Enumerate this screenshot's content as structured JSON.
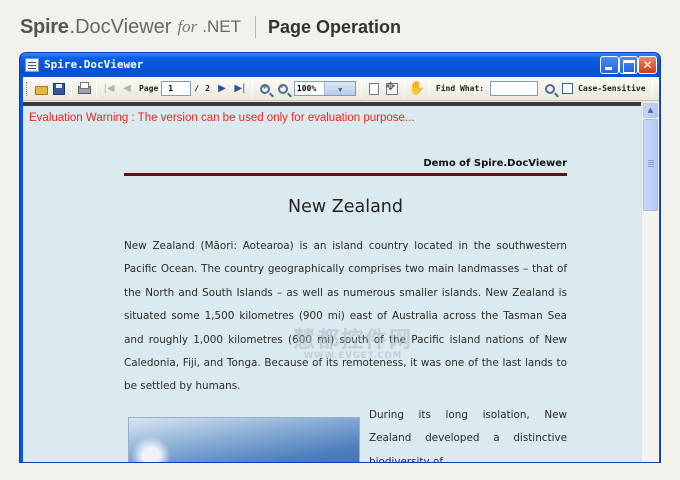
{
  "brand": {
    "product": "Spire",
    "product_suffix": ".DocViewer",
    "for_text": "for",
    "platform": ".NET",
    "section_title": "Page Operation"
  },
  "window": {
    "title": "Spire.DocViewer",
    "minimize": "",
    "maximize": "",
    "close": "✕"
  },
  "toolbar": {
    "page_label": "Page",
    "current_page": "1",
    "page_sep": "/",
    "total_pages": "2",
    "zoom_value": "100%",
    "zoom_arrow": "▼",
    "find_label": "Find What:",
    "case_label": "Case-Sensitive",
    "first_icon": "|◀",
    "prev_icon": "◀",
    "next_icon": "▶",
    "last_icon": "▶|",
    "hand_icon": "✋"
  },
  "document": {
    "warning": "Evaluation Warning : The version can be used only for evaluation purpose...",
    "header": "Demo of Spire.DocViewer",
    "title": "New Zealand",
    "paragraph": "New Zealand (Māori: Aotearoa) is an island country located in the southwestern Pacific Ocean. The country geographically comprises two main landmasses – that of the North and South Islands – as well as numerous  smaller islands. New Zealand is situated some 1,500 kilometres (900 mi) east of Australia across the Tasman Sea and roughly 1,000 kilometres (600 mi) south of the Pacific island nations of New Caledonia, Fiji, and Tonga. Because of its remoteness, it was one of the last lands to be settled by humans.",
    "paragraph2": "During its long isolation, New Zealand developed a distinctive biodiversity of",
    "watermark": "慧都控件网",
    "watermark_url": "WWW.EVGET.COM"
  },
  "scrollbar": {
    "up_arrow": "▲"
  }
}
